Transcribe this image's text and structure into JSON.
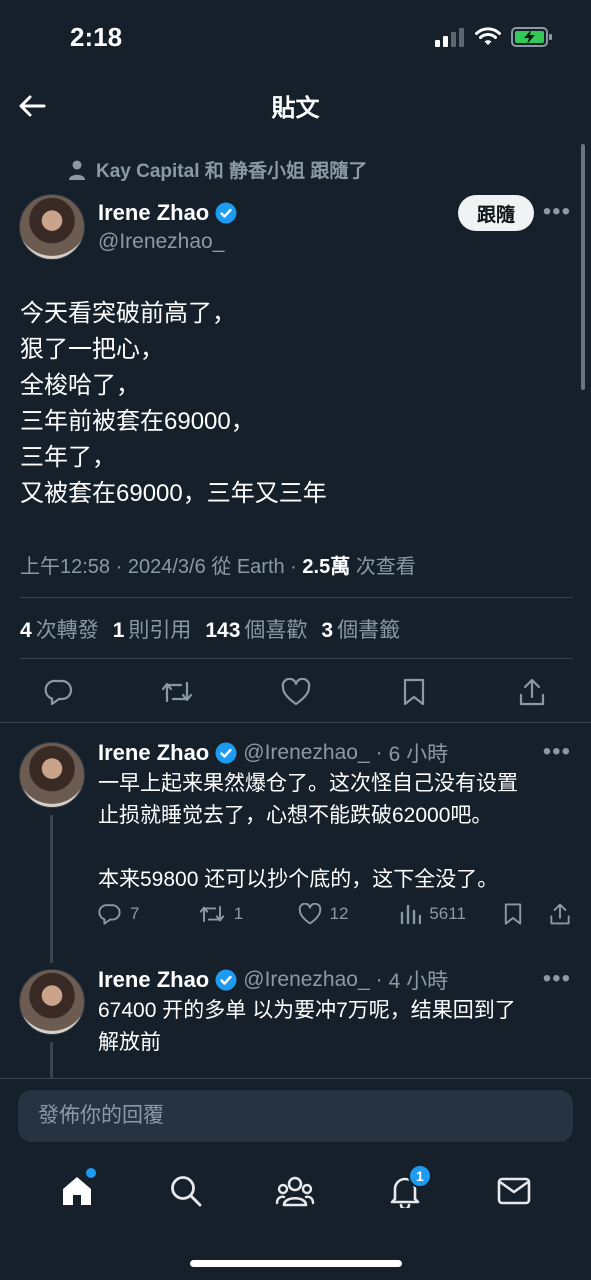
{
  "status_bar": {
    "time": "2:18"
  },
  "header": {
    "title": "貼文"
  },
  "social_context": {
    "text": "Kay Capital 和 静香小姐 跟隨了"
  },
  "author": {
    "name": "Irene Zhao",
    "handle": "@Irenezhao_",
    "follow_label": "跟隨"
  },
  "tweet": {
    "lines": [
      "今天看突破前高了，",
      "狠了一把心，",
      "全梭哈了，",
      "三年前被套在69000，",
      "三年了，",
      "又被套在69000，三年又三年"
    ],
    "time": "上午12:58",
    "date": "2024/3/6",
    "source": "從 Earth",
    "views_count": "2.5萬",
    "views_label": "次查看"
  },
  "stats": {
    "retweets_count": "4",
    "retweets_label": "次轉發",
    "quotes_count": "1",
    "quotes_label": "則引用",
    "likes_count": "143",
    "likes_label": "個喜歡",
    "bookmarks_count": "3",
    "bookmarks_label": "個書籤"
  },
  "replies": [
    {
      "name": "Irene Zhao",
      "handle": "@Irenezhao_",
      "time": "6 小時",
      "lines": [
        "一早上起来果然爆仓了。这次怪自己没有设置",
        "止损就睡觉去了，心想不能跌破62000吧。",
        "",
        "本来59800 还可以抄个底的，这下全没了。"
      ],
      "replies_count": "7",
      "retweets_count": "1",
      "likes_count": "12",
      "views_count": "5611"
    },
    {
      "name": "Irene Zhao",
      "handle": "@Irenezhao_",
      "time": "4 小時",
      "lines": [
        "67400 开的多单 以为要冲7万呢，结果回到了",
        "解放前"
      ]
    }
  ],
  "composer": {
    "placeholder": "發佈你的回覆"
  },
  "nav": {
    "notifications_badge": "1"
  },
  "colors": {
    "background": "#15202b",
    "accent": "#1d9bf0",
    "divider": "#38444d"
  }
}
